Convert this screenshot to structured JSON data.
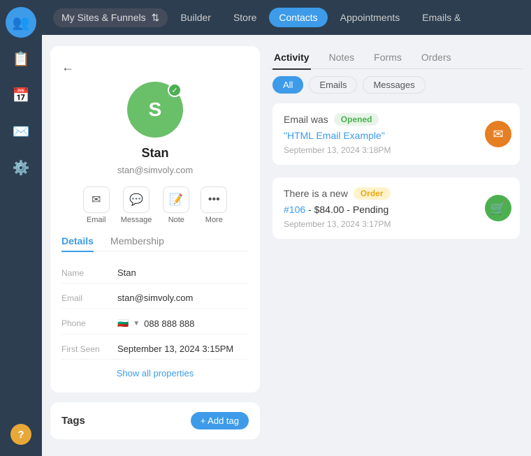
{
  "sidebar": {
    "items": [
      {
        "name": "contacts",
        "icon": "👥",
        "active": true
      },
      {
        "name": "documents",
        "icon": "📋",
        "active": false
      },
      {
        "name": "calendar",
        "icon": "📅",
        "active": false
      },
      {
        "name": "mail",
        "icon": "✉️",
        "active": false
      },
      {
        "name": "settings",
        "icon": "⚙️",
        "active": false
      }
    ],
    "help_label": "?"
  },
  "topnav": {
    "switcher_label": "My Sites & Funnels",
    "items": [
      {
        "label": "Builder",
        "active": false
      },
      {
        "label": "Store",
        "active": false
      },
      {
        "label": "Contacts",
        "active": true
      },
      {
        "label": "Appointments",
        "active": false
      },
      {
        "label": "Emails &",
        "active": false
      }
    ]
  },
  "contact": {
    "avatar_letter": "S",
    "name": "Stan",
    "email": "stan@simvoly.com",
    "actions": [
      {
        "label": "Email",
        "icon": "✉"
      },
      {
        "label": "Message",
        "icon": "💬"
      },
      {
        "label": "Note",
        "icon": "📝"
      },
      {
        "label": "More",
        "icon": "•••"
      }
    ],
    "tabs": [
      {
        "label": "Details",
        "active": true
      },
      {
        "label": "Membership",
        "active": false
      }
    ],
    "details": {
      "name_label": "Name",
      "name_value": "Stan",
      "email_label": "Email",
      "email_value": "stan@simvoly.com",
      "phone_label": "Phone",
      "phone_value": "088 888 888",
      "phone_flag": "🇧🇬",
      "first_seen_label": "First Seen",
      "first_seen_value": "September 13, 2024 3:15PM"
    },
    "show_all_label": "Show all properties"
  },
  "tags": {
    "label": "Tags",
    "add_label": "+ Add tag"
  },
  "right_panel": {
    "tabs": [
      {
        "label": "Activity",
        "active": true
      },
      {
        "label": "Notes",
        "active": false
      },
      {
        "label": "Forms",
        "active": false
      },
      {
        "label": "Orders",
        "active": false
      }
    ],
    "filters": [
      {
        "label": "All",
        "active": true
      },
      {
        "label": "Emails",
        "active": false
      },
      {
        "label": "Messages",
        "active": false
      }
    ],
    "activities": [
      {
        "id": "email-activity",
        "prefix": "Email was",
        "badge": "Opened",
        "badge_type": "opened",
        "link_text": "\"HTML Email Example\"",
        "timestamp": "September 13, 2024 3:18PM",
        "icon": "✉",
        "icon_type": "email"
      },
      {
        "id": "order-activity",
        "prefix": "There is a new",
        "badge": "Order",
        "badge_type": "order",
        "link_prefix": "#106",
        "link_suffix": "- $84.00 - Pending",
        "timestamp": "September 13, 2024 3:17PM",
        "icon": "🛒",
        "icon_type": "order"
      }
    ]
  }
}
